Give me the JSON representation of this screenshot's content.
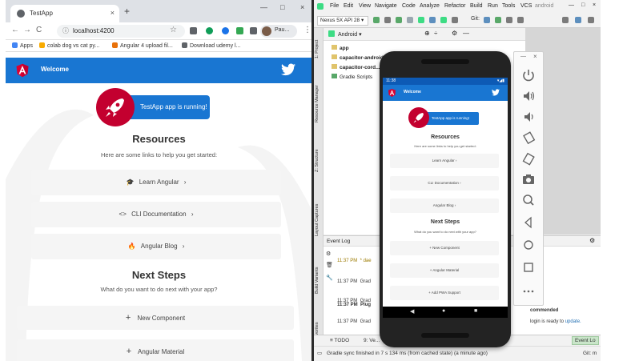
{
  "browser": {
    "tab_title": "TestApp",
    "tab_close": "×",
    "new_tab": "+",
    "window_controls": [
      "—",
      "□",
      "×"
    ],
    "nav": [
      "←",
      "→",
      "C",
      "⌂"
    ],
    "url": "localhost:4200",
    "profile_label": "Pau...",
    "menu_icon": "⋮",
    "bookmarks": [
      {
        "label": "Apps",
        "color": "#4285f4"
      },
      {
        "label": "colab dog vs cat py...",
        "color": "#f9ab00"
      },
      {
        "label": "Angular 4 upload fil...",
        "color": "#e8710a"
      },
      {
        "label": "Download udemy l...",
        "color": "#5f6368"
      }
    ],
    "extension_colors": [
      "#5f6368",
      "#0f9d58",
      "#1a73e8",
      "#34a853",
      "#5f6368"
    ]
  },
  "app": {
    "toolbar_title": "Welcome",
    "running_text": "TestApp app is running!",
    "resources_title": "Resources",
    "resources_subtitle": "Here are some links to help you get started:",
    "cards": [
      {
        "icon": "🎓",
        "label": "Learn Angular",
        "chevron": "›"
      },
      {
        "icon": "<>",
        "label": "CLI Documentation",
        "chevron": "›"
      },
      {
        "icon": "🔥",
        "label": "Angular Blog",
        "chevron": "›"
      }
    ],
    "next_steps_title": "Next Steps",
    "next_steps_subtitle": "What do you want to do next with your app?",
    "next_cards": [
      {
        "icon": "+",
        "label": "New Component"
      },
      {
        "icon": "+",
        "label": "Angular Material"
      }
    ],
    "colors": {
      "primary": "#1976d2",
      "logo_red": "#c3002f"
    }
  },
  "studio": {
    "menus": [
      "File",
      "Edit",
      "View",
      "Navigate",
      "Code",
      "Analyze",
      "Refactor",
      "Build",
      "Run",
      "Tools",
      "VCS",
      "android"
    ],
    "device": "Nexus 5X API 28 ▾",
    "project_view": "Android ▾",
    "tree": [
      {
        "label": "app",
        "bold": true
      },
      {
        "label": "capacitor-android",
        "bold": true
      },
      {
        "label": "capacitor-cord...",
        "bold": true
      },
      {
        "label": "Gradle Scripts",
        "bold": false
      }
    ],
    "side_tabs": [
      "1: Project",
      "Resource Manager",
      "Z: Structure",
      "Layout Captures",
      "Build Variants",
      "Favorites"
    ],
    "event_log": {
      "title": "Event Log",
      "rows": [
        {
          "time": "11:37 PM",
          "text": "* dae",
          "color": "#9c7a00"
        },
        {
          "time": "11:37 PM",
          "text": "Grad",
          "color": "#333"
        },
        {
          "time": "11:37 PM",
          "text": "Grad",
          "color": "#333"
        },
        {
          "time": "11:37 PM",
          "text": "Plug",
          "color": "#333",
          "bold": true
        },
        {
          "time": "11:37 PM",
          "text": "Grad",
          "color": "#333"
        }
      ],
      "right_bold": "commended",
      "right_text": "login is ready to",
      "right_link": "update."
    },
    "bottom_tabs": [
      "≡ TODO",
      "9: Ve..."
    ],
    "event_log_tab": "Event Lo",
    "status_text": "Gradle sync finished in 7 s 134 ms (from cached state) (a minute ago)",
    "status_right": "Git: m"
  },
  "phone": {
    "status_time": "11:38",
    "status_right": "▾◢▮",
    "toolbar_title": "Welcome",
    "running_text": "TestApp app is running!",
    "resources_title": "Resources",
    "resources_subtitle": "Here are some links to help you get started:",
    "cards": [
      "Learn Angular ›",
      "CLI Documentation ›",
      "Angular Blog ›"
    ],
    "next_steps_title": "Next Steps",
    "next_steps_subtitle": "What do you want to do next with your app?",
    "next_cards": [
      "+  New Component",
      "+  Angular Material",
      "+  Add PWA Support"
    ],
    "nav": [
      "◀",
      "●",
      "■"
    ]
  },
  "emulator_tools": [
    "power-icon",
    "volume-up-icon",
    "volume-down-icon",
    "rotate-left-icon",
    "rotate-right-icon",
    "camera-icon",
    "zoom-icon",
    "back-icon",
    "home-icon",
    "overview-icon",
    "more-icon"
  ]
}
